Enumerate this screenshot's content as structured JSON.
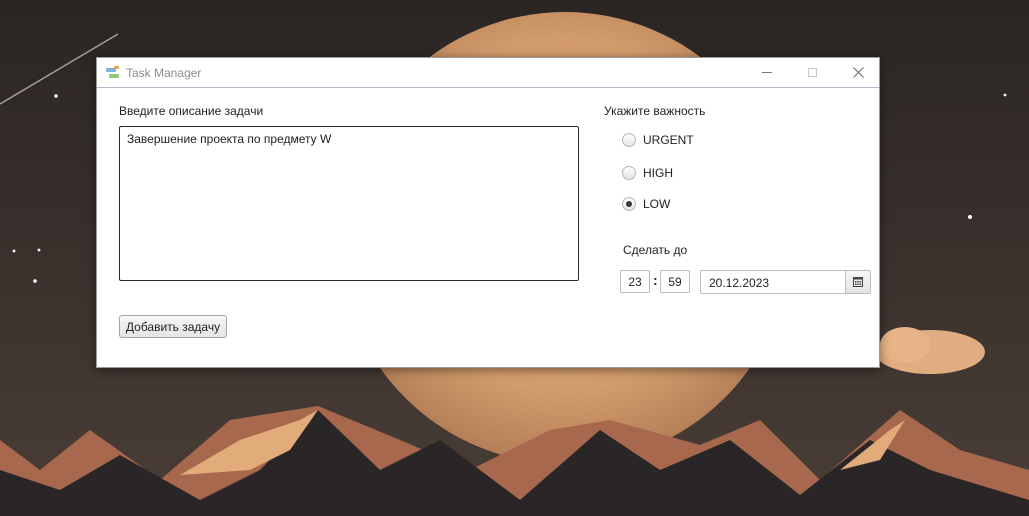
{
  "window": {
    "title": "Task Manager"
  },
  "form": {
    "description_label": "Введите описание задачи",
    "description_value": "Завершение проекта по предмету W",
    "add_button": "Добавить задачу",
    "priority_label": "Укажите важность",
    "priorities": [
      {
        "label": "URGENT",
        "selected": false
      },
      {
        "label": "HIGH",
        "selected": false
      },
      {
        "label": "LOW",
        "selected": true
      }
    ],
    "deadline_label": "Сделать до",
    "hour": "23",
    "minute": "59",
    "date": "20.12.2023"
  },
  "icons": {
    "app": "task-manager-app-icon",
    "minimize": "minimize-icon",
    "maximize": "maximize-icon",
    "close": "close-icon",
    "calendar": "calendar-icon"
  }
}
